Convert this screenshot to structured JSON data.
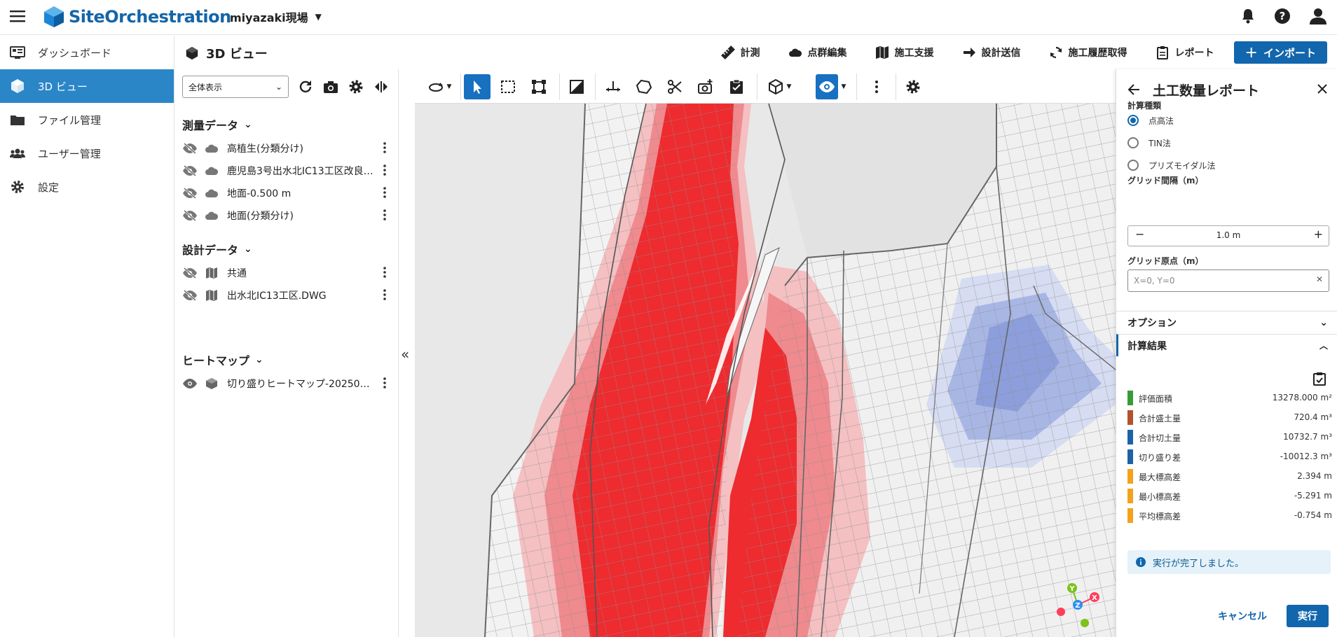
{
  "app": {
    "name": "SiteOrchestration",
    "site_name": "miyazaki現場"
  },
  "sidebar": {
    "items": [
      {
        "label": "ダッシュボード",
        "icon": "dashboard-icon"
      },
      {
        "label": "3D ビュー",
        "icon": "cube-icon"
      },
      {
        "label": "ファイル管理",
        "icon": "folder-icon"
      },
      {
        "label": "ユーザー管理",
        "icon": "users-icon"
      },
      {
        "label": "設定",
        "icon": "gear-icon"
      }
    ]
  },
  "page": {
    "title": "3D ビュー",
    "actions": [
      "計測",
      "点群編集",
      "施工支援",
      "設計送信",
      "施工履歴取得",
      "レポート"
    ],
    "import_label": "インポート"
  },
  "layers": {
    "view_select": "全体表示",
    "groups": [
      {
        "title": "測量データ",
        "items": [
          "高植生(分類分け)",
          "鹿児島3号出水北IC13工区改良…",
          "地面-0.500 m",
          "地面(分類分け)"
        ]
      },
      {
        "title": "設計データ",
        "items": [
          "共通",
          "出水北IC13工区.DWG"
        ]
      },
      {
        "title": "ヒートマップ",
        "items": [
          "切り盛りヒートマップ-202503…"
        ]
      }
    ]
  },
  "panel": {
    "title": "土工数量レポート",
    "calc_type_label": "計算種類",
    "calc_types": [
      "点高法",
      "TIN法",
      "プリズモイダル法"
    ],
    "selected_calc_type": "点高法",
    "grid_spacing_label": "グリッド間隔（m）",
    "grid_spacing_value": "1.0 m",
    "grid_origin_label": "グリッド原点（m）",
    "grid_origin_placeholder": "X=0, Y=0",
    "options_label": "オプション",
    "results_label": "計算結果",
    "results": [
      {
        "label": "評価面積",
        "value": "13278.000 m²",
        "color": "#3a9a3a"
      },
      {
        "label": "合計盛土量",
        "value": "720.4 m³",
        "color": "#b5522e"
      },
      {
        "label": "合計切土量",
        "value": "10732.7 m³",
        "color": "#1b63a6"
      },
      {
        "label": "切り盛り差",
        "value": "-10012.3 m³",
        "color": "#1b63a6"
      },
      {
        "label": "最大標高差",
        "value": "2.394 m",
        "color": "#f2a31c"
      },
      {
        "label": "最小標高差",
        "value": "-5.291 m",
        "color": "#f2a31c"
      },
      {
        "label": "平均標高差",
        "value": "-0.754 m",
        "color": "#f2a31c"
      }
    ],
    "alert": "実行が完了しました。",
    "cancel_label": "キャンセル",
    "run_label": "実行"
  },
  "axes_gizmo": {
    "x": "X",
    "y": "Y",
    "z": "Z"
  },
  "colors": {
    "primary": "#1266ad",
    "active_nav": "#2b86c8",
    "fill": "#ee2b2f",
    "cut": "#5b79c9"
  }
}
